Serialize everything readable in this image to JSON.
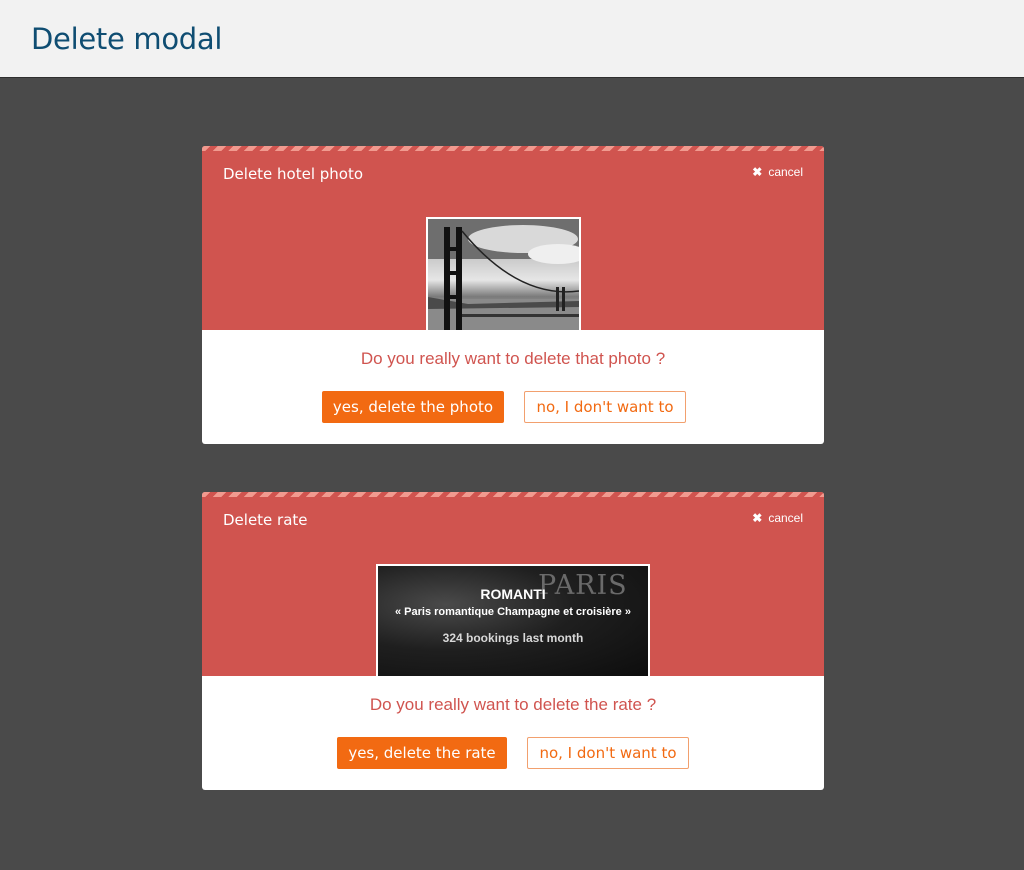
{
  "page": {
    "title": "Delete modal"
  },
  "modals": [
    {
      "title": "Delete hotel photo",
      "cancel_label": "cancel",
      "cancel_icon": "close-icon",
      "thumbnail": {
        "type": "photo",
        "subject": "bridge-photo"
      },
      "question": "Do you really want to delete that photo ?",
      "confirm_label": "yes, delete the photo",
      "decline_label": "no, I don't want to"
    },
    {
      "title": "Delete rate",
      "cancel_label": "cancel",
      "cancel_icon": "close-icon",
      "thumbnail": {
        "type": "rate-card",
        "watermark": "PARIS",
        "name": "ROMANTI",
        "subtitle": "« Paris romantique Champagne et croisière »",
        "bookings": "324 bookings last month"
      },
      "question": "Do you really want to delete the rate ?",
      "confirm_label": "yes, delete the rate",
      "decline_label": "no, I don't want to"
    }
  ],
  "colors": {
    "header_bg": "#f2f2f2",
    "title_color": "#0f4d72",
    "overlay_bg": "#4a4a4a",
    "modal_accent": "#d0544f",
    "stripe": "#f19a8f",
    "button_orange": "#f26a12"
  }
}
